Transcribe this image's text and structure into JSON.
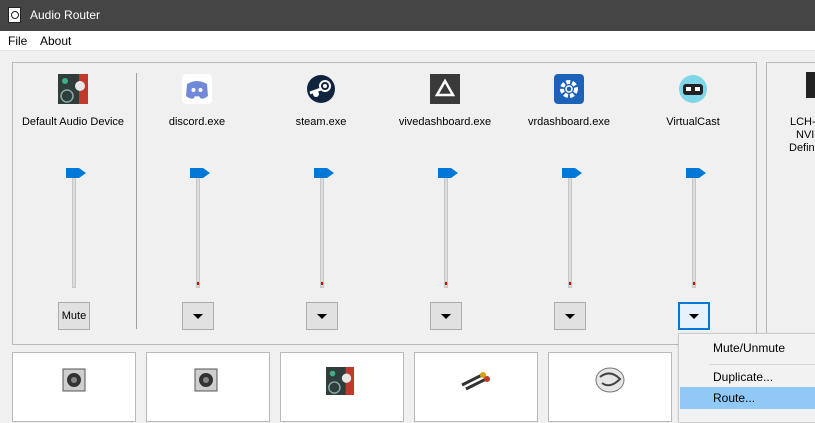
{
  "window": {
    "title": "Audio Router"
  },
  "menu": {
    "file": "File",
    "about": "About"
  },
  "default_device": {
    "label": "Default Audio Device",
    "mute_label": "Mute"
  },
  "apps": [
    {
      "name": "discord.exe",
      "icon": "discord-icon"
    },
    {
      "name": "steam.exe",
      "icon": "steam-icon"
    },
    {
      "name": "vivedashboard.exe",
      "icon": "vive-icon"
    },
    {
      "name": "vrdashboard.exe",
      "icon": "steamvr-icon"
    },
    {
      "name": "VirtualCast",
      "icon": "virtualcast-icon"
    }
  ],
  "right_panel": {
    "line1": "LCH-",
    "line2": "NVI",
    "line3": "Defini"
  },
  "context_menu": {
    "mute_unmute": "Mute/Unmute",
    "duplicate": "Duplicate...",
    "route": "Route..."
  }
}
